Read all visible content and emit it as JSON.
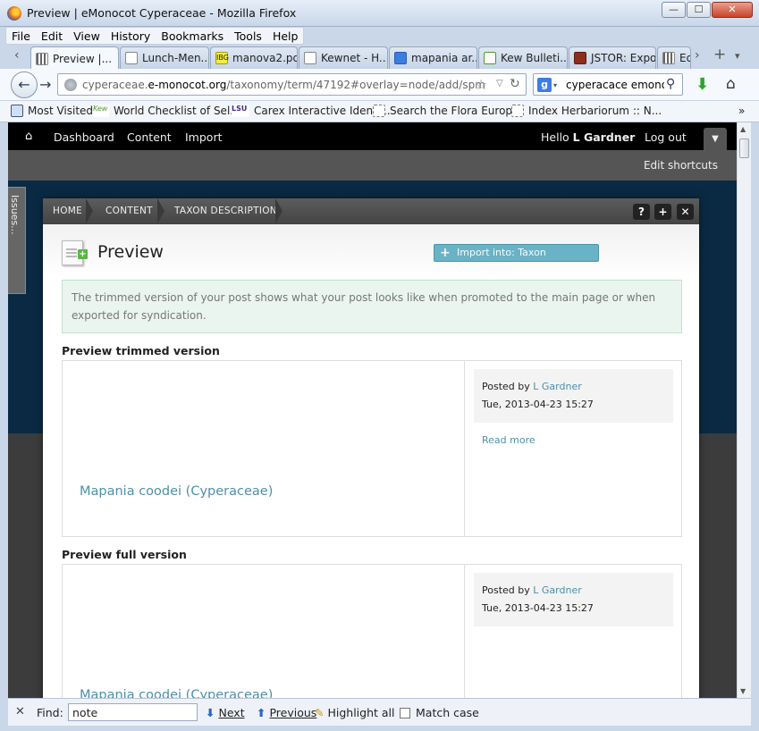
{
  "window": {
    "title": "Preview | eMonocot Cyperaceae - Mozilla Firefox",
    "controls": {
      "minimize": "—",
      "maximize": "☐",
      "close": "✕"
    }
  },
  "menu": [
    "File",
    "Edit",
    "View",
    "History",
    "Bookmarks",
    "Tools",
    "Help"
  ],
  "tabs": [
    {
      "label": "Preview |...",
      "icon": "grid-icon",
      "active": true
    },
    {
      "label": "Lunch-Men...",
      "icon": "page-icon"
    },
    {
      "label": "manova2.pdf",
      "icon": "ibg-icon",
      "icon_text": "IBG"
    },
    {
      "label": "Kewnet - H...",
      "icon": "page-icon"
    },
    {
      "label": "mapania ar...",
      "icon": "google-icon"
    },
    {
      "label": "Kew Bulleti...",
      "icon": "kew-icon"
    },
    {
      "label": "JSTOR: Expo...",
      "icon": "jstor-icon"
    },
    {
      "label": "Ed",
      "icon": "grid-icon"
    }
  ],
  "tab_close": "✕",
  "tab_controls": {
    "prev": "‹",
    "next": "›",
    "new": "+",
    "list": "▾"
  },
  "navbar": {
    "back": "←",
    "forward": "→",
    "url_domain_prefix": "cyperaceae.",
    "url_domain": "e-monocot.org",
    "url_path": "/taxonomy/term/47192#overlay=node/add/spm",
    "search_engine": "g",
    "search_value": "cyperacace emonocot",
    "star": "☆",
    "dropdown": "▽",
    "reload": "↻",
    "search_glyph": "⚲",
    "download": "⬇",
    "home": "⌂"
  },
  "bookmarks": [
    {
      "label": "Most Visited",
      "icon": "most-visited-icon"
    },
    {
      "label": "World Checklist of Sel...",
      "icon": "kew-icon",
      "icon_text": "Kew"
    },
    {
      "label": "Carex Interactive Identi...",
      "icon": "lsu-icon",
      "icon_text": "LSU"
    },
    {
      "label": "Search the Flora Europ...",
      "icon": "page-icon"
    },
    {
      "label": "Index Herbariorum :: N...",
      "icon": "page-icon"
    }
  ],
  "bookmarks_more": "»",
  "admin_toolbar": {
    "home_glyph": "⌂",
    "links": [
      "Dashboard",
      "Content",
      "Import"
    ],
    "hello_prefix": "Hello ",
    "user": "L Gardner",
    "logout": "Log out",
    "toggle": "▼",
    "edit_shortcuts": "Edit shortcuts"
  },
  "issues_tab": "Issues...",
  "overlay": {
    "breadcrumbs": [
      "HOME",
      "CONTENT",
      "TAXON DESCRIPTION"
    ],
    "buttons": {
      "help": "?",
      "add": "+",
      "close": "✕"
    },
    "title": "Preview",
    "import_button": "Import into: Taxon Description",
    "import_plus": "+",
    "notice": "The trimmed version of your post shows what your post looks like when promoted to the main page or when exported for syndication.",
    "trimmed": {
      "heading": "Preview trimmed version",
      "posted_by": "Posted by",
      "user": "L Gardner",
      "date": "Tue, 2013-04-23 15:27",
      "read_more": "Read more",
      "node_title": "Mapania coodei (Cyperaceae)"
    },
    "full": {
      "heading": "Preview full version",
      "posted_by": "Posted by",
      "user": "L Gardner",
      "date": "Tue, 2013-04-23 15:27",
      "node_title": "Mapania coodei (Cyperaceae)"
    }
  },
  "scrollbar": {
    "up": "▲",
    "down": "▼"
  },
  "findbar": {
    "close": "✕",
    "label": "Find:",
    "value": "note",
    "next_arrow": "⬇",
    "next": "Next",
    "prev_arrow": "⬆",
    "previous": "Previous",
    "highlight_glyph": "✎",
    "highlight": "Highlight all",
    "match_case": "Match case"
  }
}
